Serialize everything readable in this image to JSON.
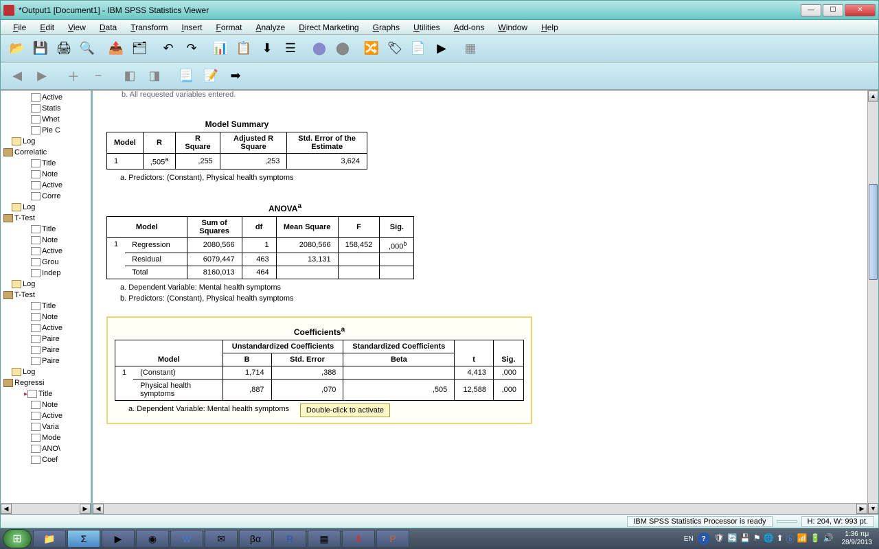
{
  "window": {
    "title": "*Output1 [Document1] - IBM SPSS Statistics Viewer"
  },
  "menus": [
    "File",
    "Edit",
    "View",
    "Data",
    "Transform",
    "Insert",
    "Format",
    "Analyze",
    "Direct Marketing",
    "Graphs",
    "Utilities",
    "Add-ons",
    "Window",
    "Help"
  ],
  "outline": {
    "items": [
      {
        "label": "Active",
        "icon": "page",
        "indent": 1
      },
      {
        "label": "Statis",
        "icon": "page",
        "indent": 1
      },
      {
        "label": "Whet",
        "icon": "page",
        "indent": 1
      },
      {
        "label": "Pie C",
        "icon": "page",
        "indent": 1
      },
      {
        "label": "Log",
        "icon": "log",
        "indent": 0,
        "group": true
      },
      {
        "label": "Correlatic",
        "icon": "book",
        "indent": 0,
        "group": true,
        "expand": "-"
      },
      {
        "label": "Title",
        "icon": "page",
        "indent": 1
      },
      {
        "label": "Note",
        "icon": "page",
        "indent": 1
      },
      {
        "label": "Active",
        "icon": "page",
        "indent": 1
      },
      {
        "label": "Corre",
        "icon": "page",
        "indent": 1
      },
      {
        "label": "Log",
        "icon": "log",
        "indent": 0,
        "group": true
      },
      {
        "label": "T-Test",
        "icon": "book",
        "indent": 0,
        "group": true,
        "expand": "-"
      },
      {
        "label": "Title",
        "icon": "page",
        "indent": 1
      },
      {
        "label": "Note",
        "icon": "page",
        "indent": 1
      },
      {
        "label": "Active",
        "icon": "page",
        "indent": 1
      },
      {
        "label": "Grou",
        "icon": "page",
        "indent": 1
      },
      {
        "label": "Indep",
        "icon": "page",
        "indent": 1
      },
      {
        "label": "Log",
        "icon": "log",
        "indent": 0,
        "group": true
      },
      {
        "label": "T-Test",
        "icon": "book",
        "indent": 0,
        "group": true,
        "expand": "-"
      },
      {
        "label": "Title",
        "icon": "page",
        "indent": 1
      },
      {
        "label": "Note",
        "icon": "page",
        "indent": 1
      },
      {
        "label": "Active",
        "icon": "page",
        "indent": 1
      },
      {
        "label": "Paire",
        "icon": "page",
        "indent": 1
      },
      {
        "label": "Paire",
        "icon": "page",
        "indent": 1
      },
      {
        "label": "Paire",
        "icon": "page",
        "indent": 1
      },
      {
        "label": "Log",
        "icon": "log",
        "indent": 0,
        "group": true
      },
      {
        "label": "Regressi",
        "icon": "book",
        "indent": 0,
        "group": true,
        "expand": "-"
      },
      {
        "label": "Title",
        "icon": "page",
        "indent": 1,
        "arrow": true
      },
      {
        "label": "Note",
        "icon": "page",
        "indent": 1
      },
      {
        "label": "Active",
        "icon": "page",
        "indent": 1
      },
      {
        "label": "Varia",
        "icon": "page",
        "indent": 1
      },
      {
        "label": "Mode",
        "icon": "page",
        "indent": 1
      },
      {
        "label": "ANO\\",
        "icon": "page",
        "indent": 1
      },
      {
        "label": "Coef",
        "icon": "page",
        "indent": 1
      }
    ]
  },
  "content": {
    "cutoff": "b. All requested variables entered.",
    "model_summary": {
      "title": "Model Summary",
      "headers": [
        "Model",
        "R",
        "R Square",
        "Adjusted R Square",
        "Std. Error of the Estimate"
      ],
      "row": {
        "model": "1",
        "r": ",505",
        "rsup": "a",
        "r2": ",255",
        "adjr2": ",253",
        "se": "3,624"
      },
      "note_a": "a. Predictors: (Constant), Physical health symptoms"
    },
    "anova": {
      "title": "ANOVA",
      "title_sup": "a",
      "headers": [
        "Model",
        "",
        "Sum of Squares",
        "df",
        "Mean Square",
        "F",
        "Sig."
      ],
      "rows": [
        {
          "m": "1",
          "lbl": "Regression",
          "ss": "2080,566",
          "df": "1",
          "ms": "2080,566",
          "f": "158,452",
          "sig": ",000",
          "sigsup": "b"
        },
        {
          "m": "",
          "lbl": "Residual",
          "ss": "6079,447",
          "df": "463",
          "ms": "13,131",
          "f": "",
          "sig": ""
        },
        {
          "m": "",
          "lbl": "Total",
          "ss": "8160,013",
          "df": "464",
          "ms": "",
          "f": "",
          "sig": ""
        }
      ],
      "note_a": "a. Dependent Variable: Mental health symptoms",
      "note_b": "b. Predictors: (Constant), Physical health symptoms"
    },
    "coef": {
      "title": "Coefficients",
      "title_sup": "a",
      "super_headers": {
        "unstd": "Unstandardized Coefficients",
        "std": "Standardized Coefficients"
      },
      "headers": [
        "Model",
        "",
        "B",
        "Std. Error",
        "Beta",
        "t",
        "Sig."
      ],
      "rows": [
        {
          "m": "1",
          "lbl": "(Constant)",
          "b": "1,714",
          "se": ",388",
          "beta": "",
          "t": "4,413",
          "sig": ",000"
        },
        {
          "m": "",
          "lbl": "Physical health symptoms",
          "b": ",887",
          "se": ",070",
          "beta": ",505",
          "t": "12,588",
          "sig": ",000"
        }
      ],
      "note_a": "a. Dependent Variable: Mental health symptoms",
      "tooltip": "Double-click to activate"
    }
  },
  "status": {
    "processor": "IBM SPSS Statistics Processor is ready",
    "dims": "H: 204, W: 993 pt."
  },
  "tray": {
    "lang": "EN",
    "time": "1:36 πμ",
    "date": "28/9/2013"
  }
}
